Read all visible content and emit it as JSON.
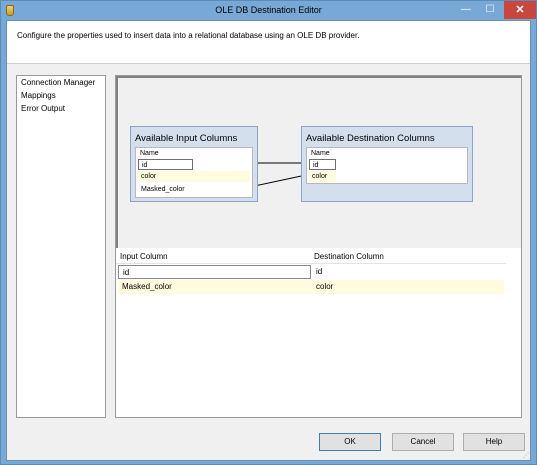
{
  "window": {
    "title": "OLE DB Destination Editor",
    "minimize_glyph": "—",
    "maximize_glyph": "☐",
    "close_glyph": "✕"
  },
  "header": {
    "description": "Configure the properties used to insert data into a relational database using an OLE DB provider."
  },
  "nav": {
    "items": [
      {
        "label": "Connection Manager"
      },
      {
        "label": "Mappings"
      },
      {
        "label": "Error Output"
      }
    ]
  },
  "diagram": {
    "input_box": {
      "title": "Available Input Columns",
      "header": "Name",
      "columns": [
        "id",
        "color",
        "Masked_color"
      ]
    },
    "dest_box": {
      "title": "Available Destination Columns",
      "header": "Name",
      "columns": [
        "id",
        "color"
      ]
    }
  },
  "grid": {
    "headers": [
      "Input Column",
      "Destination Column"
    ],
    "rows": [
      {
        "input": "id",
        "destination": "id"
      },
      {
        "input": "Masked_color",
        "destination": "color"
      }
    ]
  },
  "buttons": {
    "ok": "OK",
    "cancel": "Cancel",
    "help": "Help"
  },
  "colors": {
    "title_bar": "#78a8d6",
    "close_button": "#c7463d",
    "column_box": "#d4dfee",
    "highlight_row": "#fffbdf"
  }
}
